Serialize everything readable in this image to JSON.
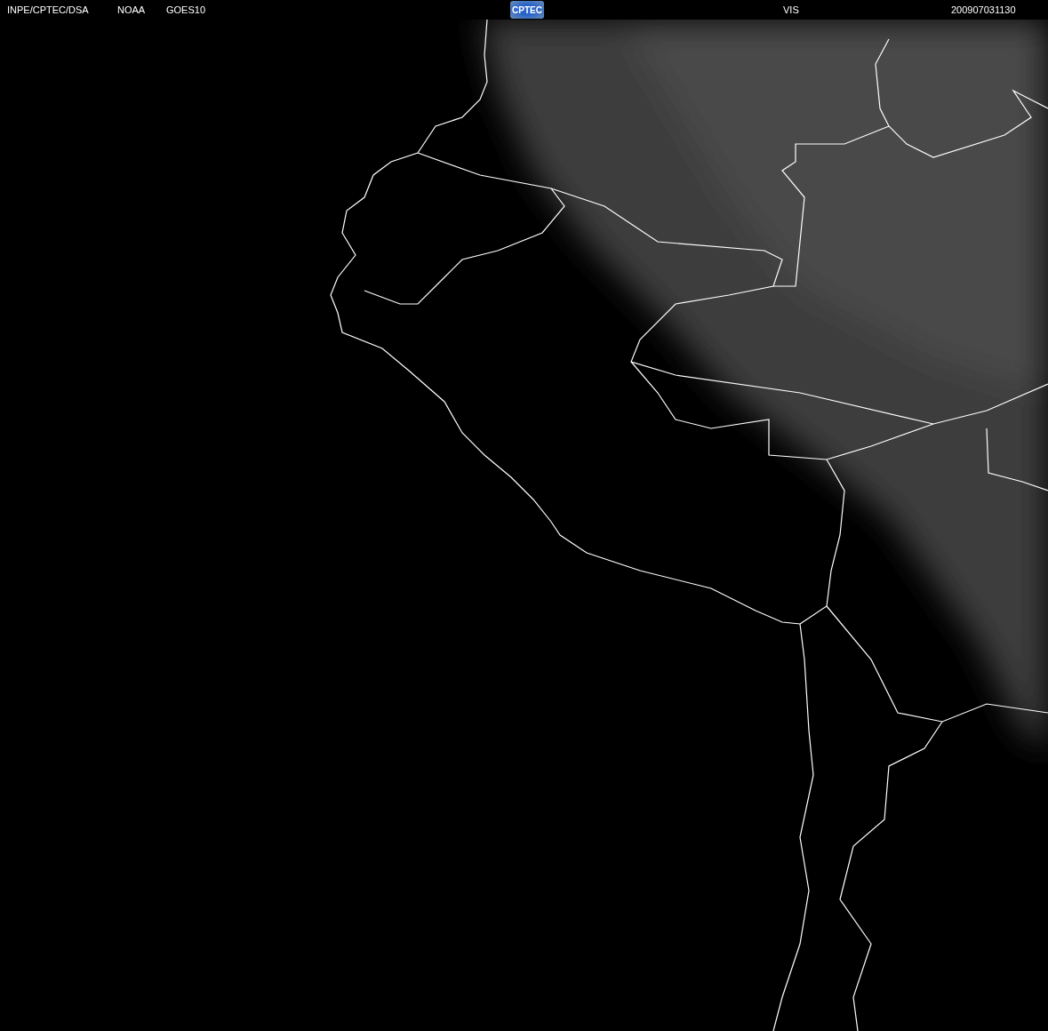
{
  "header": {
    "source": "INPE/CPTEC/DSA",
    "agency": "NOAA",
    "satellite": "GOES10",
    "logo": "CPTEC",
    "channel": "VIS",
    "timestamp": "200907031130"
  }
}
